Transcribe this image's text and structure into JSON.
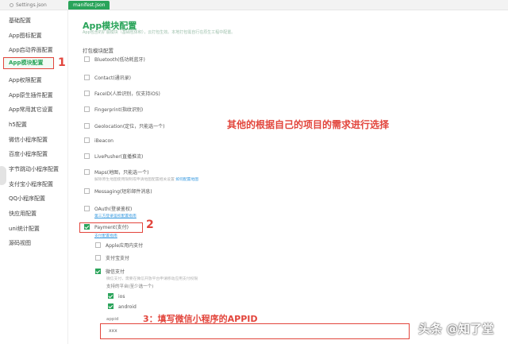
{
  "tabs": [
    {
      "label": "Settings.json"
    },
    {
      "label": "manifest.json"
    }
  ],
  "sidebar": {
    "items": [
      {
        "label": "基础配置"
      },
      {
        "label": "App图标配置"
      },
      {
        "label": "App启动界面配置"
      },
      {
        "label": "App模块配置"
      },
      {
        "label": "App权限配置"
      },
      {
        "label": "App原生插件配置"
      },
      {
        "label": "App常用其它设置"
      },
      {
        "label": "h5配置"
      },
      {
        "label": "微信小程序配置"
      },
      {
        "label": "百度小程序配置"
      },
      {
        "label": "字节跳动小程序配置"
      },
      {
        "label": "支付宝小程序配置"
      },
      {
        "label": "QQ小程序配置"
      },
      {
        "label": "快应用配置"
      },
      {
        "label": "uni统计配置"
      },
      {
        "label": "源码视图"
      }
    ]
  },
  "annotations": {
    "num1": "1",
    "num2": "2",
    "note": "其他的根据自己的项目的需求进行选择",
    "step3": "3：填写微信小程序的APPID"
  },
  "main": {
    "title": "App模块配置",
    "description": "App包含的扩展模块（基础包体积），云打包生效。本地打包需自行在原生工程中配置。",
    "section": "打包模块配置",
    "modules": [
      {
        "label": "Bluetooth(低功耗蓝牙)",
        "checked": false
      },
      {
        "label": "Contact(通讯录)",
        "checked": false
      },
      {
        "label": "FaceID(人脸识别，仅支持iOS)",
        "checked": false
      },
      {
        "label": "Fingerprint(指纹识别)",
        "checked": false
      },
      {
        "label": "Geolocation(定位，只能选一个)",
        "checked": false
      },
      {
        "label": "iBeacon",
        "checked": false
      },
      {
        "label": "LivePusher(直播推流)",
        "checked": false
      },
      {
        "label": "Maps(地图，只能选一个)",
        "checked": false
      },
      {
        "label": "Messaging(短彩邮件消息)",
        "checked": false
      },
      {
        "label": "OAuth(登录鉴权)",
        "checked": false
      },
      {
        "label": "Payment(支付)",
        "checked": true
      }
    ],
    "maps_note": "解除原生地图使用限制或申请地图配置相关设置",
    "maps_link": "如何配置地图",
    "oauth_link": "第三方登录鉴权配置指南",
    "payment_link": "支付配置指南",
    "payment_subs": [
      {
        "label": "Apple应用内支付",
        "checked": false
      },
      {
        "label": "支付宝支付",
        "checked": false
      },
      {
        "label": "微信支付",
        "checked": true
      }
    ],
    "wechat_note": "微信支付，需要在微信开放平台申请移动应用支付权限",
    "platform_label": "支持的平台(至少选一个)",
    "platforms": [
      {
        "label": "ios",
        "checked": true
      },
      {
        "label": "android",
        "checked": true
      }
    ],
    "appid_label": "appid",
    "appid_value": "xxx"
  },
  "watermark": "头条 @知了堂"
}
